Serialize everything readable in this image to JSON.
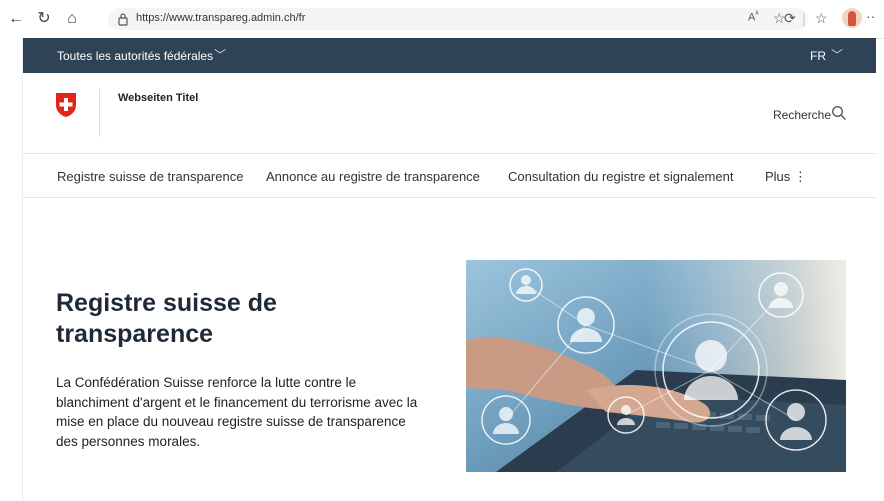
{
  "browser": {
    "url": "https://www.transpareg.admin.ch/fr",
    "read_aloud": "Aᴬ"
  },
  "fedbar": {
    "authorities_label": "Toutes les autorités fédérales",
    "language": "FR"
  },
  "header": {
    "site_title": "Webseiten Titel",
    "search_label": "Recherche"
  },
  "mainnav": {
    "items": [
      "Registre suisse de transparence",
      "Annonce au registre de transparence",
      "Consultation du registre et signalement",
      "Plus"
    ]
  },
  "hero": {
    "title": "Registre suisse de transparence",
    "text": "La Confédération Suisse renforce la lutte contre le blanchiment d'argent et le financement du terrorisme avec la mise en place du nouveau registre suisse de transparence des personnes morales."
  },
  "colors": {
    "fedbar": "#2f4356",
    "swiss_red": "#e1251b"
  }
}
